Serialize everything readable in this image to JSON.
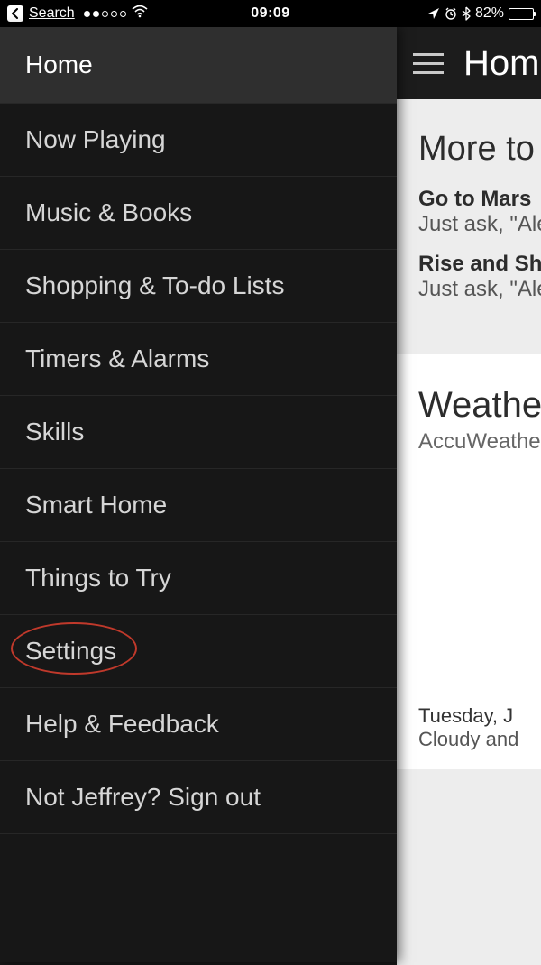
{
  "status": {
    "back_label": "Search",
    "time": "09:09",
    "battery_text": "82%",
    "battery_pct": 82
  },
  "sidebar": {
    "items": [
      {
        "label": "Home"
      },
      {
        "label": "Now Playing"
      },
      {
        "label": "Music & Books"
      },
      {
        "label": "Shopping & To-do Lists"
      },
      {
        "label": "Timers & Alarms"
      },
      {
        "label": "Skills"
      },
      {
        "label": "Smart Home"
      },
      {
        "label": "Things to Try"
      },
      {
        "label": "Settings"
      },
      {
        "label": "Help & Feedback"
      },
      {
        "label": "Not Jeffrey? Sign out"
      }
    ],
    "highlighted_index": 8
  },
  "main": {
    "title": "Home",
    "card1": {
      "heading": "More to try",
      "item1_title": "Go to Mars",
      "item1_sub": "Just ask, \"Alexa…",
      "item2_title": "Rise and Shine",
      "item2_sub": "Just ask, \"Alexa…"
    },
    "weather": {
      "heading": "Weather",
      "sub": "AccuWeather",
      "day": "Tuesday, J",
      "desc": "Cloudy and"
    }
  }
}
